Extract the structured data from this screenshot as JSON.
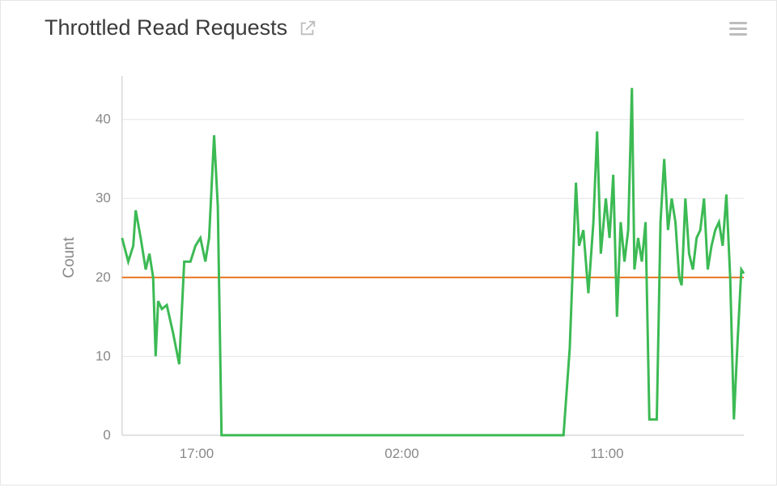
{
  "header": {
    "title": "Throttled Read Requests",
    "popout_icon": "external-link-icon",
    "menu_icon": "hamburger-icon"
  },
  "chart_data": {
    "type": "line",
    "title": "Throttled Read Requests",
    "ylabel": "Count",
    "xlabel": "",
    "ylim": [
      0,
      45
    ],
    "y_ticks": [
      0,
      10,
      20,
      30,
      40
    ],
    "x_tick_labels": [
      "17:00",
      "02:00",
      "11:00"
    ],
    "x_tick_positions": [
      0.12,
      0.45,
      0.78
    ],
    "threshold": 20,
    "series": [
      {
        "name": "Throttled Read Requests",
        "color": "#3cba54",
        "x": [
          0.0,
          0.01,
          0.018,
          0.022,
          0.03,
          0.038,
          0.044,
          0.05,
          0.054,
          0.058,
          0.064,
          0.072,
          0.082,
          0.092,
          0.1,
          0.11,
          0.118,
          0.126,
          0.134,
          0.14,
          0.148,
          0.154,
          0.16,
          0.168,
          0.176,
          0.184,
          0.19,
          0.198,
          0.208,
          0.22,
          0.24,
          0.28,
          0.34,
          0.42,
          0.52,
          0.6,
          0.66,
          0.7,
          0.71,
          0.72,
          0.73,
          0.735,
          0.742,
          0.75,
          0.758,
          0.764,
          0.77,
          0.778,
          0.784,
          0.79,
          0.796,
          0.802,
          0.808,
          0.814,
          0.82,
          0.824,
          0.83,
          0.836,
          0.842,
          0.848,
          0.854,
          0.86,
          0.866,
          0.872,
          0.878,
          0.884,
          0.89,
          0.896,
          0.9,
          0.906,
          0.912,
          0.918,
          0.924,
          0.93,
          0.936,
          0.942,
          0.948,
          0.954,
          0.96,
          0.966,
          0.972,
          0.978,
          0.984,
          0.99,
          0.996,
          1.0
        ],
        "values": [
          25,
          22,
          24,
          28.5,
          25,
          21,
          23,
          20,
          10,
          17,
          16,
          16.5,
          13,
          9,
          22,
          22,
          24,
          25,
          22,
          25,
          38,
          29,
          0,
          0,
          0,
          0,
          0,
          0,
          0,
          0,
          0,
          0,
          0,
          0,
          0,
          0,
          0,
          0,
          0,
          11,
          32,
          24,
          26,
          18,
          27,
          38.5,
          23,
          30,
          25,
          33,
          15,
          27,
          22,
          26,
          44,
          21,
          25,
          22,
          27,
          2,
          2,
          2,
          27,
          35,
          26,
          30,
          27,
          20,
          19,
          30,
          23,
          21,
          25,
          26,
          30,
          21,
          24,
          26,
          27,
          24,
          30.5,
          20,
          2,
          12,
          21,
          20.5
        ]
      }
    ]
  }
}
